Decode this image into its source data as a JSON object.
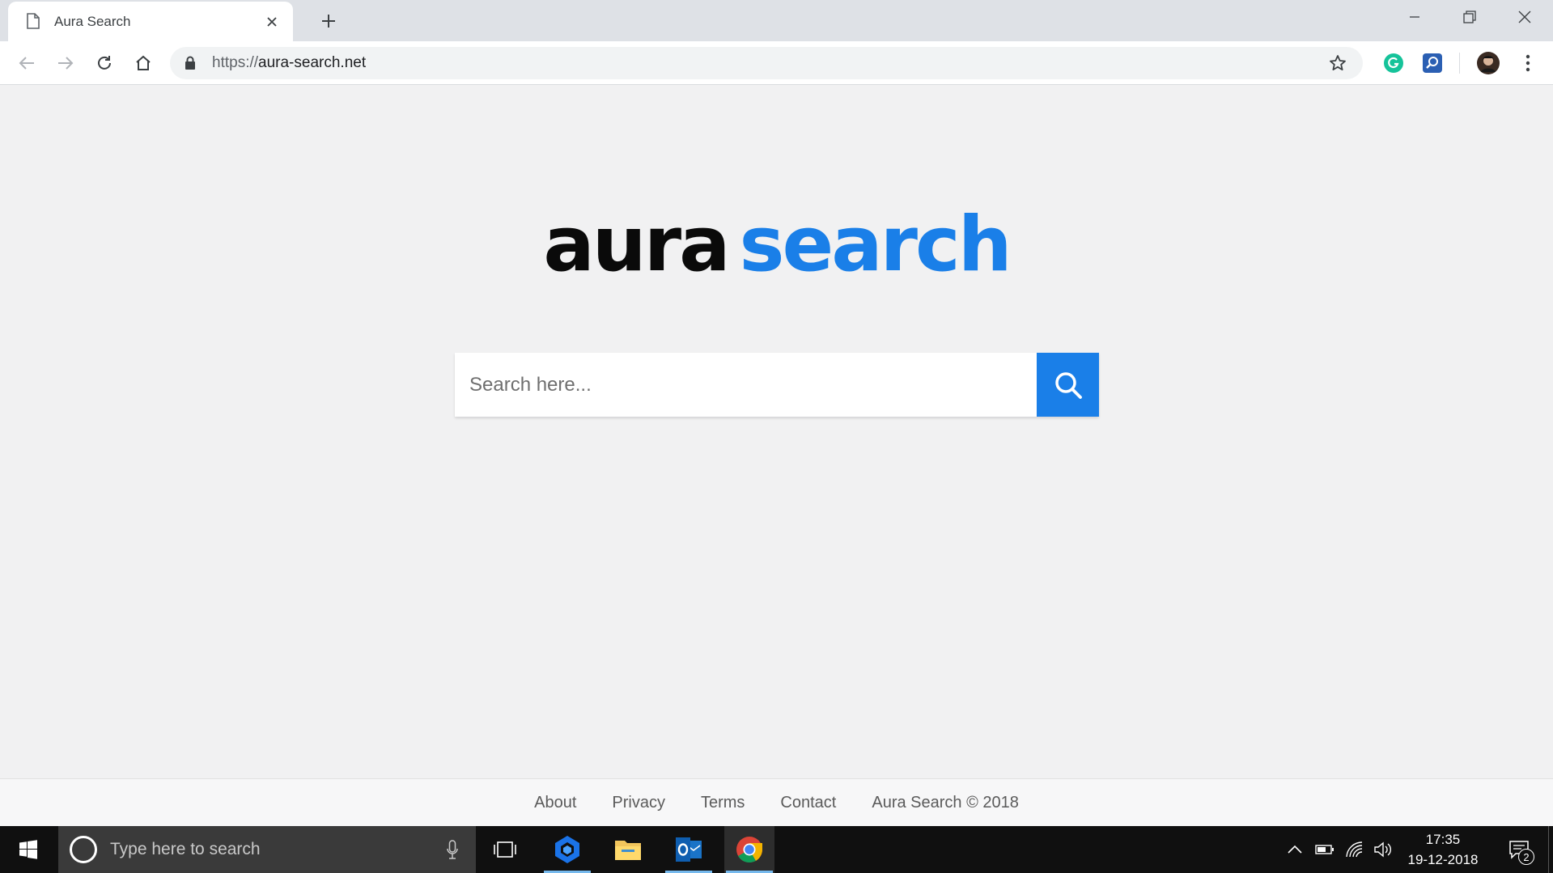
{
  "browser": {
    "tab": {
      "title": "Aura Search"
    },
    "url": {
      "scheme": "https://",
      "host": "aura-search.net"
    }
  },
  "page": {
    "logo": {
      "word1": "aura",
      "word2": "search"
    },
    "search": {
      "placeholder": "Search here..."
    },
    "footer": {
      "links": [
        "About",
        "Privacy",
        "Terms",
        "Contact"
      ],
      "copyright": "Aura Search © 2018"
    }
  },
  "taskbar": {
    "search_placeholder": "Type here to search",
    "time": "17:35",
    "date": "19-12-2018",
    "notification_count": "2"
  },
  "colors": {
    "brand_blue": "#1a7fe8",
    "page_bg": "#f1f1f2",
    "taskbar_bg": "#101010"
  },
  "icons": [
    "page-icon",
    "close-icon",
    "plus-icon",
    "minimize-icon",
    "restore-icon",
    "back-icon",
    "forward-icon",
    "reload-icon",
    "home-icon",
    "lock-icon",
    "star-icon",
    "grammarly-icon",
    "extension-search-icon",
    "avatar",
    "kebab-menu-icon",
    "search-icon",
    "windows-icon",
    "cortana-icon",
    "mic-icon",
    "task-view-icon",
    "app-icon",
    "folder-icon",
    "outlook-icon",
    "chrome-icon",
    "chevron-up-icon",
    "battery-icon",
    "wifi-icon",
    "volume-icon",
    "notification-icon"
  ]
}
